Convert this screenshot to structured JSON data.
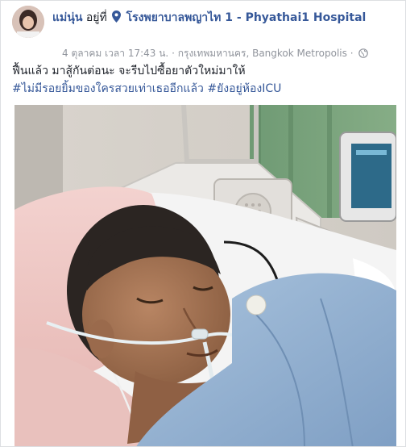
{
  "post": {
    "author": "แม่นุ่น",
    "at_word": "อยู่ที่",
    "place": "โรงพยาบาลพญาไท 1 - Phyathai1 Hospital",
    "date": "4 ตุลาคม เวลา 17:43 น.",
    "location": "กรุงเทพมหานคร, Bangkok Metropolis",
    "separator": "·",
    "text": "ฟื้นแล้ว มาสู้กันต่อนะ จะรีบไปซื้อยาตัวใหม่มาให้",
    "hashtags": [
      "#ไม่มีรอยยิ้มของใครสวยเท่าเธออีกแล้ว",
      "#ยังอยู่ห้องICU"
    ]
  },
  "icons": {
    "place": "map-pin-icon",
    "privacy": "globe-icon"
  },
  "colors": {
    "link": "#365899",
    "meta": "#90949c",
    "text": "#1d2129"
  }
}
